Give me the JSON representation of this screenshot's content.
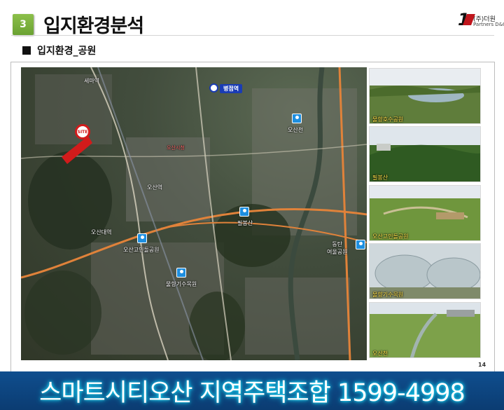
{
  "header": {
    "section_number": "3",
    "title": "입지환경분석",
    "subtitle": "입지환경_공원"
  },
  "logo": {
    "mark": "1",
    "name": "(주)더원",
    "sub": "Partners D&C"
  },
  "map": {
    "station_label": "병점역",
    "site_label": "SITE",
    "park_labels": {
      "osancheon": "오산천",
      "pilbongsan": "필봉산",
      "gorinpark": "오산고인돌공원",
      "mulhyanggi": "물향기수목원",
      "dongtan": "동탄\n여울공원"
    },
    "place_labels": {
      "a": "오산시청",
      "b": "세마역",
      "c": "오산역",
      "d": "오산대역"
    },
    "colors": {
      "pin": "#1e8fe0",
      "site": "#d21b1b",
      "station": "#1a3cb5",
      "road": "#e0823a"
    }
  },
  "photos": [
    {
      "caption": "물향호수공원"
    },
    {
      "caption": "필봉산"
    },
    {
      "caption": "오산고인돌공원"
    },
    {
      "caption": "물향기수목원"
    },
    {
      "caption": "오산천"
    }
  ],
  "page_number": "14",
  "banner": {
    "text": "스마트시티오산 지역주택조합  1599-4998",
    "color": "#0f4e8e"
  }
}
